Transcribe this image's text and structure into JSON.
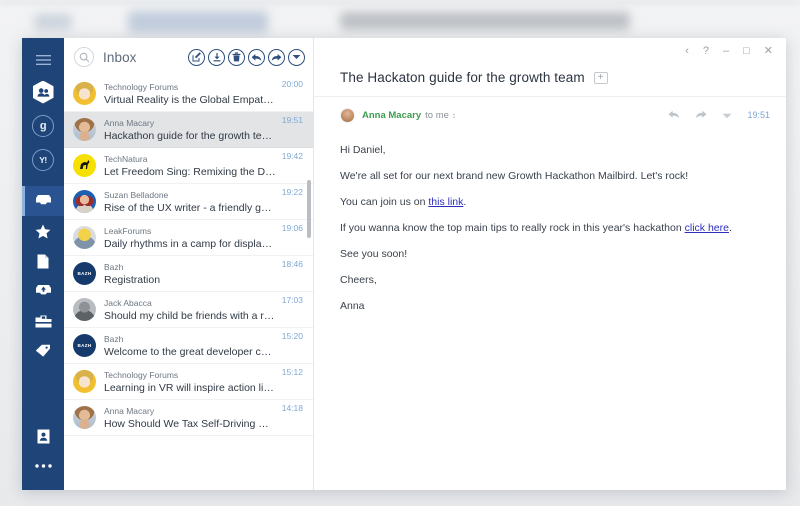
{
  "background": {
    "description": "blurred desktop behind window",
    "colors": {
      "base": "#eceeef",
      "ghost": "#b9c6d8"
    }
  },
  "theme": {
    "sidebar_bg": "#1e4478",
    "sidebar_selected_bg": "#2a5391",
    "accent_blue": "#2e4f7d",
    "time_blue": "#7fa8d4",
    "sender_green": "#3e9b4f",
    "link_color": "#2f2fbf",
    "selected_row_bg": "#e3e4e6"
  },
  "sidebar": {
    "menu": {
      "label": "Menu",
      "icon": "hamburger-icon"
    },
    "accounts": [
      {
        "id": "primary",
        "icon": "people-avatar-icon",
        "label": "Primary account",
        "active": true
      },
      {
        "id": "google",
        "icon": "google-icon",
        "label": "g",
        "active": false
      },
      {
        "id": "yahoo",
        "icon": "yahoo-icon",
        "label": "Y!",
        "active": false
      }
    ],
    "items": [
      {
        "id": "inbox",
        "icon": "inbox-icon",
        "label": "Inbox",
        "selected": true
      },
      {
        "id": "starred",
        "icon": "star-icon",
        "label": "Starred",
        "selected": false
      },
      {
        "id": "drafts",
        "icon": "document-icon",
        "label": "Drafts",
        "selected": false
      },
      {
        "id": "archive",
        "icon": "archive-icon",
        "label": "Archive",
        "selected": false
      },
      {
        "id": "folders",
        "icon": "folder-icon",
        "label": "Folders",
        "selected": false
      },
      {
        "id": "labels",
        "icon": "tag-icon",
        "label": "Labels",
        "selected": false
      }
    ],
    "bottom_items": [
      {
        "id": "contacts",
        "icon": "contacts-icon",
        "label": "Contacts"
      },
      {
        "id": "more",
        "icon": "more-dots-icon",
        "label": "More"
      }
    ]
  },
  "list_pane": {
    "search": {
      "icon": "search-icon",
      "placeholder": "Search"
    },
    "folder_title": "Inbox",
    "toolbar": [
      {
        "id": "compose",
        "icon": "compose-icon",
        "label": "Compose"
      },
      {
        "id": "download",
        "icon": "download-icon",
        "label": "Download"
      },
      {
        "id": "delete",
        "icon": "trash-icon",
        "label": "Delete"
      },
      {
        "id": "reply",
        "icon": "reply-arrow-icon",
        "label": "Reply"
      },
      {
        "id": "forward",
        "icon": "forward-arrow-icon",
        "label": "Forward"
      },
      {
        "id": "more",
        "icon": "chevron-down-icon",
        "label": "More actions"
      }
    ],
    "messages": [
      {
        "sender": "Technology Forums",
        "subject": "Virtual Reality is the Global Empathy Ma…",
        "time": "20:00",
        "selected": false,
        "avatar": "avatar-tech-forums",
        "avatar_color": "#f2c02e"
      },
      {
        "sender": "Anna Macary",
        "subject": "Hackathon guide for the growth team",
        "time": "19:51",
        "selected": true,
        "avatar": "avatar-anna",
        "avatar_color": "#cfd6de"
      },
      {
        "sender": "TechNatura",
        "subject": "Let Freedom Sing: Remixing the Declarati…",
        "time": "19:42",
        "selected": false,
        "avatar": "avatar-technatura",
        "avatar_color": "#f5e000"
      },
      {
        "sender": "Suzan Belladone",
        "subject": "Rise of the UX writer - a friendly guide of…",
        "time": "19:22",
        "selected": false,
        "avatar": "avatar-suzan",
        "avatar_color": "#1f5fb0"
      },
      {
        "sender": "LeakForums",
        "subject": "Daily rhythms in a camp for displaced pe…",
        "time": "19:06",
        "selected": false,
        "avatar": "avatar-leakforums",
        "avatar_color": "#d8dce1"
      },
      {
        "sender": "Bazh",
        "subject": "Registration",
        "time": "18:46",
        "selected": false,
        "avatar": "avatar-bazh",
        "avatar_color": "#173a6d",
        "initials": "BAZH"
      },
      {
        "sender": "Jack Abacca",
        "subject": "Should my child be friends with a robot…",
        "time": "17:03",
        "selected": false,
        "avatar": "avatar-jack",
        "avatar_color": "#b9bdc2"
      },
      {
        "sender": "Bazh",
        "subject": "Welcome to the great developer commu…",
        "time": "15:20",
        "selected": false,
        "avatar": "avatar-bazh",
        "avatar_color": "#173a6d",
        "initials": "BAZH"
      },
      {
        "sender": "Technology Forums",
        "subject": "Learning in VR will inspire action like nev…",
        "time": "15:12",
        "selected": false,
        "avatar": "avatar-tech-forums",
        "avatar_color": "#f2c02e"
      },
      {
        "sender": "Anna Macary",
        "subject": "How Should We Tax Self-Driving Cars?",
        "time": "14:18",
        "selected": false,
        "avatar": "avatar-anna",
        "avatar_color": "#cfd6de"
      }
    ]
  },
  "window_controls": [
    {
      "id": "back",
      "icon": "chevron-left-icon",
      "glyph": "‹"
    },
    {
      "id": "help",
      "icon": "question-mark-icon",
      "glyph": "?"
    },
    {
      "id": "minimize",
      "icon": "minimize-icon",
      "glyph": "–"
    },
    {
      "id": "maximize",
      "icon": "maximize-icon",
      "glyph": "□"
    },
    {
      "id": "close",
      "icon": "close-icon",
      "glyph": "✕"
    }
  ],
  "reading_pane": {
    "subject": "The Hackaton guide for the growth team",
    "add_tag_icon": "plus-icon",
    "add_tag_glyph": "+",
    "sender_name": "Anna Macary",
    "recipients": "to me",
    "expand_glyph": "⌃",
    "time": "19:51",
    "actions": [
      {
        "id": "reply",
        "icon": "reply-arrow-icon",
        "label": "Reply"
      },
      {
        "id": "forward",
        "icon": "forward-arrow-icon",
        "label": "Forward"
      },
      {
        "id": "more",
        "icon": "chevron-down-icon",
        "label": "More"
      }
    ],
    "body": {
      "greeting": "Hi Daniel,",
      "line1": "We're all set for our next brand new Growth Hackathon Mailbird. Let's rock!",
      "line2_pre": "You can join us on ",
      "line2_link": "this link",
      "line2_post": ".",
      "line3_pre": "If you wanna know the top main tips to really rock in this year's hackathon ",
      "line3_link": "click here",
      "line3_post": ".",
      "line4": "See you soon!",
      "signoff": "Cheers,",
      "signature": "Anna"
    }
  }
}
